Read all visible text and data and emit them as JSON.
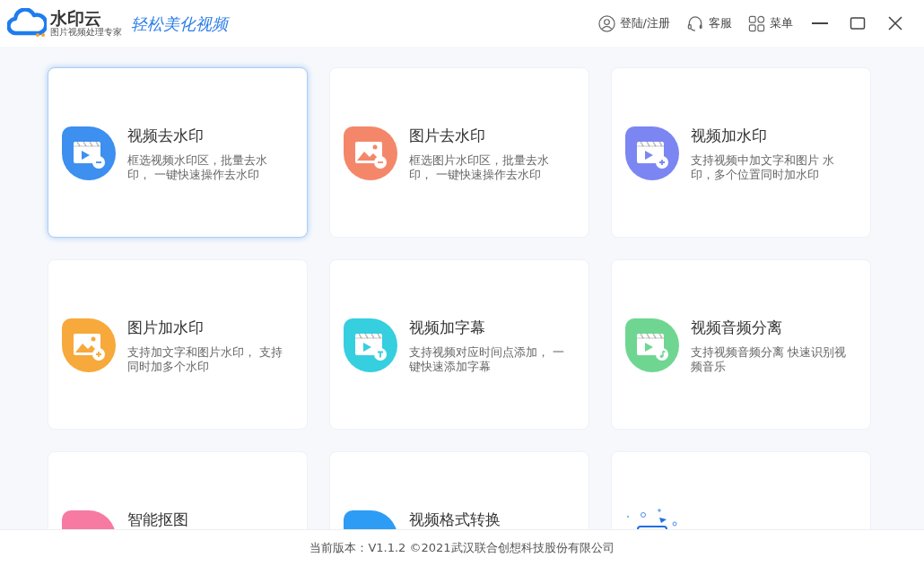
{
  "header": {
    "logo": {
      "name": "水印云",
      "tagline": "图片视频处理专家"
    },
    "slogan": "轻松美化视频",
    "actions": [
      {
        "kind": "user",
        "label": "登陆/注册"
      },
      {
        "kind": "headset",
        "label": "客服"
      },
      {
        "kind": "menu",
        "label": "菜单"
      }
    ],
    "window_controls": [
      {
        "kind": "minimize"
      },
      {
        "kind": "maximize"
      },
      {
        "kind": "close"
      }
    ]
  },
  "cards": [
    {
      "kind": "video",
      "badge": {
        "kind": "remove"
      },
      "color": "#3d8ff0",
      "title": "视频去水印",
      "description_lines": [
        "框选视频水印区，批量去水",
        "印， 一键快速操作去水印"
      ],
      "selected": true
    },
    {
      "kind": "image",
      "badge": {
        "kind": "remove"
      },
      "color": "#f4876a",
      "title": "图片去水印",
      "description_lines": [
        "框选图片水印区，批量去水",
        "印， 一键快速操作去水印"
      ],
      "selected": false
    },
    {
      "kind": "video",
      "badge": {
        "kind": "add"
      },
      "color": "#7b86f2",
      "title": "视频加水印",
      "description_lines": [
        "支持视频中加文字和图片 水",
        "印，多个位置同时加水印"
      ],
      "selected": false
    },
    {
      "kind": "image",
      "badge": {
        "kind": "add"
      },
      "color": "#f7a93c",
      "title": "图片加水印",
      "description_lines": [
        "支持加文字和图片水印， 支持",
        "同时加多个水印"
      ],
      "selected": false
    },
    {
      "kind": "video",
      "badge": {
        "kind": "text"
      },
      "color": "#35cfe0",
      "title": "视频加字幕",
      "description_lines": [
        "支持视频对应时间点添加， 一",
        "键快速添加字幕"
      ],
      "selected": false
    },
    {
      "kind": "video",
      "badge": {
        "kind": "music"
      },
      "color": "#6fd692",
      "title": "视频音频分离",
      "description_lines": [
        "支持视频音频分离 快速识别视",
        "频音乐"
      ],
      "selected": false
    },
    {
      "kind": "sparkle",
      "color": "#f77aa3",
      "title": "智能抠图",
      "selected": false
    },
    {
      "kind": "convert",
      "color": "#2d9cf5",
      "title": "视频格式转换",
      "selected": false
    },
    {
      "kind": "illustration",
      "selected": false
    }
  ],
  "footer": "当前版本：V1.1.2 ©2021武汉联合创想科技股份有限公司"
}
